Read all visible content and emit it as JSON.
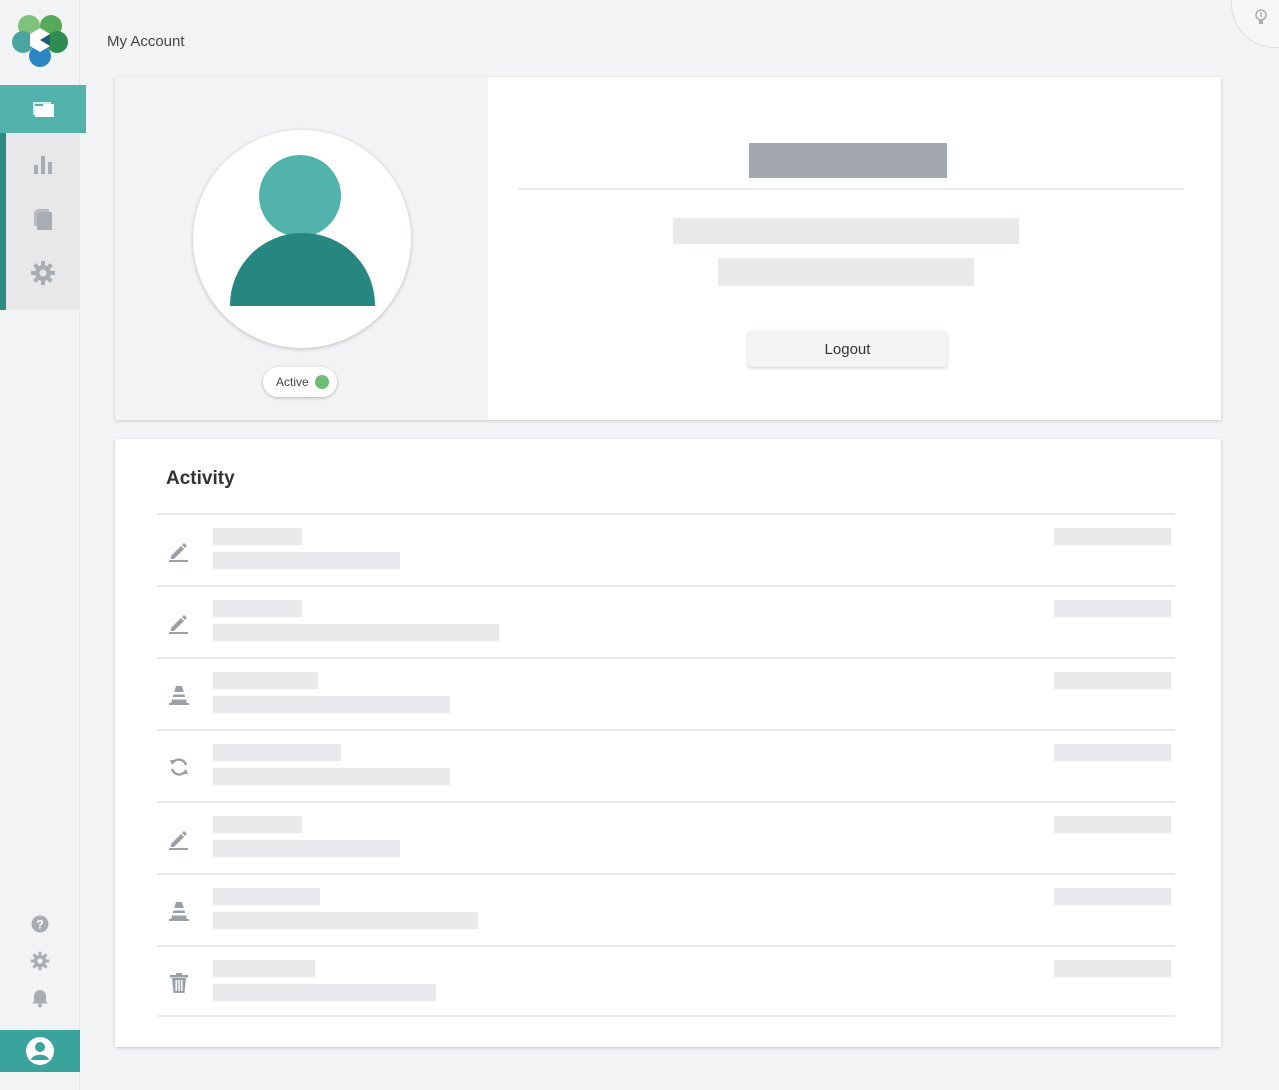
{
  "page": {
    "title": "My Account"
  },
  "sidebar": {
    "nav": [
      {
        "name": "folders-icon",
        "active": true
      },
      {
        "name": "bar-chart-icon",
        "active": false
      },
      {
        "name": "documents-icon",
        "active": false
      },
      {
        "name": "gear-icon",
        "active": false
      }
    ],
    "bottom": [
      "help-icon",
      "settings-icon",
      "bell-icon"
    ]
  },
  "profile": {
    "status_label": "Active",
    "status_color": "#6dbe74",
    "logout_label": "Logout"
  },
  "activity": {
    "title": "Activity",
    "items": [
      {
        "icon": "pencil-icon"
      },
      {
        "icon": "pencil-icon"
      },
      {
        "icon": "cone-icon"
      },
      {
        "icon": "refresh-icon"
      },
      {
        "icon": "pencil-icon"
      },
      {
        "icon": "cone-icon"
      },
      {
        "icon": "trash-icon"
      }
    ]
  },
  "colors": {
    "accent": "#52b3ac",
    "accent_dark": "#268780",
    "sidebar_bar": "#2a8a84"
  }
}
